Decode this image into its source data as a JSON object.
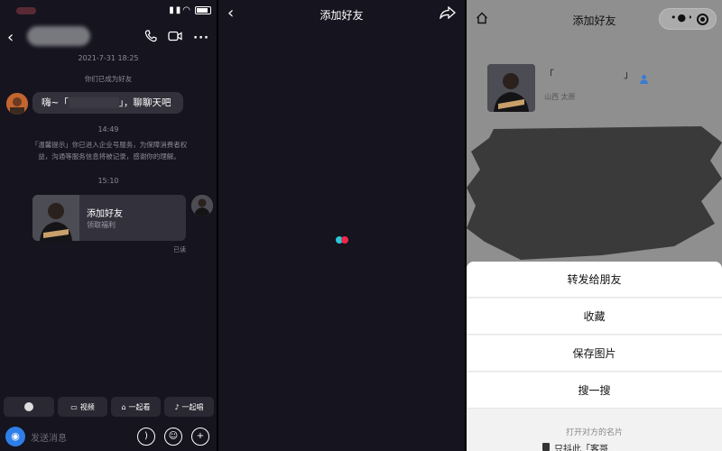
{
  "chat": {
    "date_time": "2021-7-31 18:25",
    "became_friends": "你们已成为好友",
    "greeting_prefix": "嗨~「",
    "greeting_suffix": "」，聊聊天吧",
    "time_1": "14:49",
    "notice": "「温馨提示」你已进入企业号服务，为保障消费者权益，沟通等服务信息将被记录，感谢你的理解。",
    "time_2": "15:10",
    "card_title": "添加好友",
    "card_subtitle": "领取福利",
    "read_status": "已读",
    "quick_actions": [
      "视频",
      "一起看",
      "一起唱"
    ],
    "input_placeholder": "发送消息"
  },
  "loading": {
    "title": "添加好友",
    "dot_colors": [
      "#27c9d9",
      "#f0284a"
    ]
  },
  "add_friend": {
    "title": "添加好友",
    "profile_name_open": "「",
    "profile_name_close": "」",
    "location": "山西 太原",
    "sheet_items": [
      "转发给朋友",
      "收藏",
      "保存图片",
      "搜一搜"
    ],
    "sheet_subtitle": "打开对方的名片",
    "sheet_peek": "只抖此「客哥"
  },
  "colors": {
    "chat_bg": "#15141f",
    "bubble": "#33323c",
    "accent_blue": "#2e7ee8",
    "person_icon": "#3a7bd5"
  }
}
